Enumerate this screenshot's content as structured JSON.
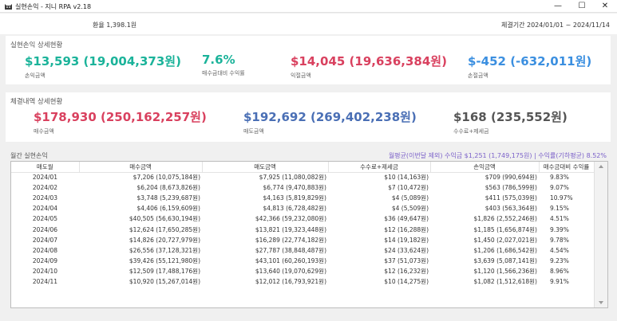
{
  "window": {
    "title": "실현손익 - 지니 RPA v2.18",
    "minimize": "—",
    "maximize": "☐",
    "close": "✕",
    "icon": "cat-icon"
  },
  "info": {
    "exchange_rate": "환율 1,398.1원",
    "period": "체결기간 2024/01/01 ~ 2024/11/14"
  },
  "realized": {
    "title": "실현손익 상세현황",
    "profit_value": "$13,593 (19,004,373원)",
    "profit_label": "손익금액",
    "rate_value": "7.6%",
    "rate_label": "매수금대비 수익률",
    "gain_value": "$14,045 (19,636,384원)",
    "gain_label": "익절금액",
    "loss_value": "$-452 (-632,011원)",
    "loss_label": "손절금액"
  },
  "execution": {
    "title": "체결내역 상세현황",
    "buy_value": "$178,930 (250,162,257원)",
    "buy_label": "매수금액",
    "sell_value": "$192,692 (269,402,238원)",
    "sell_label": "매도금액",
    "fee_value": "$168 (235,552원)",
    "fee_label": "수수료+제세금"
  },
  "monthly": {
    "title": "월간 실현손익",
    "summary": "월평균(이번달 제외) 수익금 $1,251 (1,749,175원) | 수익률(기하평균) 8.52%",
    "headers": [
      "매도월",
      "매수금액",
      "매도금액",
      "수수료+제세금",
      "손익금액",
      "매수금대비 수익률"
    ],
    "rows": [
      [
        "2024/01",
        "$7,206 (10,075,184원)",
        "$7,925 (11,080,082원)",
        "$10 (14,163원)",
        "$709 (990,694원)",
        "9.83%"
      ],
      [
        "2024/02",
        "$6,204 (8,673,826원)",
        "$6,774 (9,470,883원)",
        "$7 (10,472원)",
        "$563 (786,599원)",
        "9.07%"
      ],
      [
        "2024/03",
        "$3,748 (5,239,687원)",
        "$4,163 (5,819,829원)",
        "$4 (5,089원)",
        "$411 (575,039원)",
        "10.97%"
      ],
      [
        "2024/04",
        "$4,406 (6,159,609원)",
        "$4,813 (6,728,482원)",
        "$4 (5,509원)",
        "$403 (563,364원)",
        "9.15%"
      ],
      [
        "2024/05",
        "$40,505 (56,630,194원)",
        "$42,366 (59,232,080원)",
        "$36 (49,647원)",
        "$1,826 (2,552,246원)",
        "4.51%"
      ],
      [
        "2024/06",
        "$12,624 (17,650,285원)",
        "$13,821 (19,323,448원)",
        "$12 (16,288원)",
        "$1,185 (1,656,874원)",
        "9.39%"
      ],
      [
        "2024/07",
        "$14,826 (20,727,979원)",
        "$16,289 (22,774,182원)",
        "$14 (19,182원)",
        "$1,450 (2,027,021원)",
        "9.78%"
      ],
      [
        "2024/08",
        "$26,556 (37,128,321원)",
        "$27,787 (38,848,487원)",
        "$24 (33,624원)",
        "$1,206 (1,686,542원)",
        "4.54%"
      ],
      [
        "2024/09",
        "$39,426 (55,121,980원)",
        "$43,101 (60,260,193원)",
        "$37 (51,073원)",
        "$3,639 (5,087,141원)",
        "9.23%"
      ],
      [
        "2024/10",
        "$12,509 (17,488,176원)",
        "$13,640 (19,070,629원)",
        "$12 (16,232원)",
        "$1,120 (1,566,236원)",
        "8.96%"
      ],
      [
        "2024/11",
        "$10,920 (15,267,014원)",
        "$12,012 (16,793,921원)",
        "$10 (14,275원)",
        "$1,082 (1,512,618원)",
        "9.91%"
      ]
    ]
  },
  "colors": {
    "profit": "#1bb39a",
    "gain": "#d9415f",
    "loss": "#3b8fe0",
    "sell": "#4a6fb5",
    "summary": "#7b61c9"
  }
}
